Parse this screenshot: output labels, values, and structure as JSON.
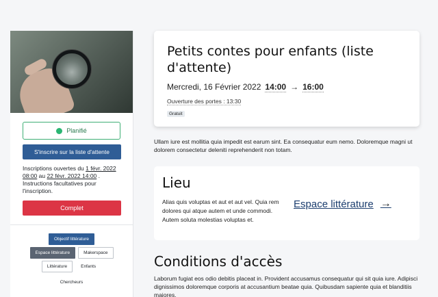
{
  "sidebar": {
    "status_label": "Planifié",
    "status_color": "#2bb673",
    "waitlist_button": "S'inscrire sur la liste d'attente",
    "registration": {
      "prefix": "Inscriptions ouvertes du",
      "start": "1 févr. 2022 08:00",
      "middle": "au",
      "end": "22 févr. 2022 14:00",
      "suffix": ". Instructions facultatives pour l'inscription."
    },
    "full_button": "Complet",
    "tags": {
      "objectif": "Objectif littérature",
      "espace": "Espace littérature",
      "makerspace": "Makerspace",
      "litterature": "Littérature",
      "enfants": "Enfants",
      "chercheurs": "Chercheurs"
    }
  },
  "event": {
    "title": "Petits contes pour enfants (liste d'attente)",
    "date": "Mercredi, 16 Février 2022",
    "start_time": "14:00",
    "arrow": "→",
    "end_time": "16:00",
    "doors": "Ouverture des portes : 13:30",
    "price_badge": "Gratuit"
  },
  "description": "Ullam iure est mollitia quia impedit est earum sint. Ea consequatur eum nemo. Doloremque magni ut dolorem consectetur deleniti reprehenderit non totam.",
  "lieu": {
    "title": "Lieu",
    "text": "Alias quis voluptas et aut et aut vel. Quia rem dolores qui atque autem et unde commodi. Autem soluta molestias voluptas et.",
    "link": "Espace littérature",
    "arrow": "→"
  },
  "conditions": {
    "title": "Conditions d'accès",
    "text": "Laborum fugiat eos odio debitis placeat in. Provident accusamus consequatur qui sit quia iure. Adipisci dignissimos doloremque corporis at accusantium beatae quia. Quibusdam sapiente quia et blanditiis maiores."
  },
  "colors": {
    "primary": "#2f5d96",
    "danger": "#dc3545",
    "success": "#2bb673"
  }
}
